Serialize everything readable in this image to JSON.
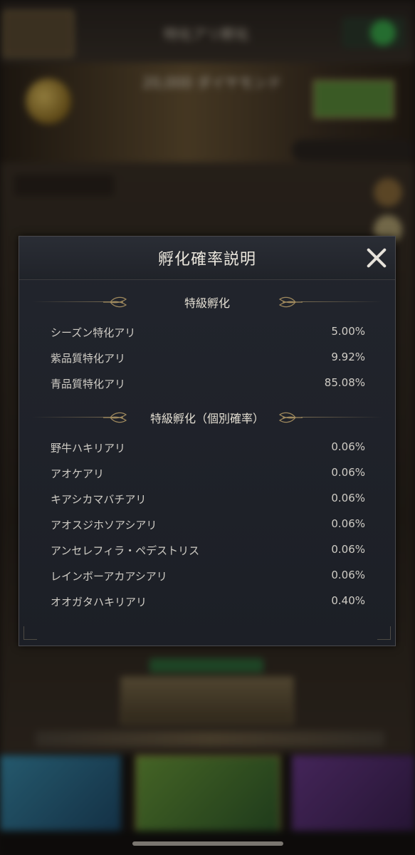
{
  "background": {
    "header_title": "特化アリ孵化",
    "banner_text": "20,000 ダイヤモンド"
  },
  "modal": {
    "title": "孵化確率説明",
    "sections": [
      {
        "title": "特級孵化",
        "rows": [
          {
            "name": "シーズン特化アリ",
            "pct": "5.00%"
          },
          {
            "name": "紫品質特化アリ",
            "pct": "9.92%"
          },
          {
            "name": "青品質特化アリ",
            "pct": "85.08%"
          }
        ]
      },
      {
        "title": "特級孵化（個別確率）",
        "rows": [
          {
            "name": "野牛ハキリアリ",
            "pct": "0.06%"
          },
          {
            "name": "アオケアリ",
            "pct": "0.06%"
          },
          {
            "name": "キアシカマバチアリ",
            "pct": "0.06%"
          },
          {
            "name": "アオスジホソアシアリ",
            "pct": "0.06%"
          },
          {
            "name": "アンセレフィラ・ペデストリス",
            "pct": "0.06%"
          },
          {
            "name": "レインボーアカアシアリ",
            "pct": "0.06%"
          },
          {
            "name": "オオガタハキリアリ",
            "pct": "0.40%"
          }
        ]
      }
    ]
  }
}
